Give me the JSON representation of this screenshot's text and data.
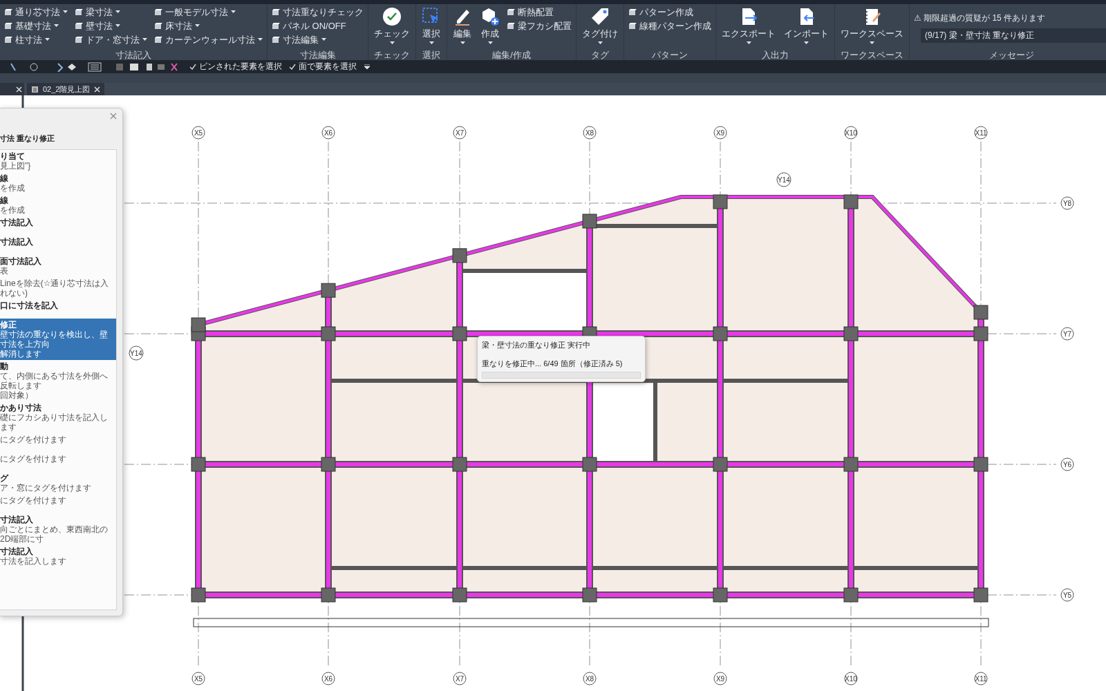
{
  "ribbon": {
    "groups": [
      {
        "label": "寸法記入",
        "items": [
          {
            "label": "通り芯寸法",
            "kind": "small",
            "dropdown": true
          },
          {
            "label": "基礎寸法",
            "kind": "small",
            "dropdown": true
          },
          {
            "label": "柱寸法",
            "kind": "small",
            "dropdown": true
          },
          {
            "label": "梁寸法",
            "kind": "small",
            "dropdown": true
          },
          {
            "label": "壁寸法",
            "kind": "small",
            "dropdown": true
          },
          {
            "label": "ドア・窓寸法",
            "kind": "small",
            "dropdown": true
          },
          {
            "label": "一般モデル寸法",
            "kind": "small",
            "dropdown": true
          },
          {
            "label": "床寸法",
            "kind": "small",
            "dropdown": true
          },
          {
            "label": "カーテンウォール寸法",
            "kind": "small",
            "dropdown": true
          }
        ]
      },
      {
        "label": "寸法編集",
        "items": [
          {
            "label": "寸法重なりチェック",
            "kind": "small",
            "dropdown": false
          },
          {
            "label": "パネル ON/OFF",
            "kind": "small",
            "dropdown": false
          },
          {
            "label": "寸法編集",
            "kind": "small",
            "dropdown": true
          }
        ]
      },
      {
        "label": "チェック",
        "items": [
          {
            "label": "チェック",
            "kind": "check",
            "dropdown": true
          }
        ]
      },
      {
        "label": "選択",
        "items": [
          {
            "label": "選択",
            "kind": "select",
            "dropdown": true
          }
        ]
      },
      {
        "label": "編集/作成",
        "items": [
          {
            "label": "編集",
            "kind": "edit",
            "dropdown": true
          },
          {
            "label": "作成",
            "kind": "create",
            "dropdown": true
          },
          {
            "label": "断熱配置",
            "kind": "small",
            "dropdown": false
          },
          {
            "label": "梁フカシ配置",
            "kind": "small",
            "dropdown": false
          }
        ]
      },
      {
        "label": "タグ",
        "items": [
          {
            "label": "タグ付け",
            "kind": "tag",
            "dropdown": true
          }
        ]
      },
      {
        "label": "パターン",
        "items": [
          {
            "label": "パターン作成",
            "kind": "small",
            "dropdown": false
          },
          {
            "label": "線種パターン作成",
            "kind": "small",
            "dropdown": false
          }
        ]
      },
      {
        "label": "入出力",
        "items": [
          {
            "label": "エクスポート",
            "kind": "export",
            "dropdown": true
          },
          {
            "label": "インポート",
            "kind": "import",
            "dropdown": true
          }
        ]
      },
      {
        "label": "ワークスペース",
        "items": [
          {
            "label": "ワークスペース",
            "kind": "workspace",
            "dropdown": true
          }
        ]
      }
    ],
    "message": {
      "label": "メッセージ",
      "warning": "⚠ 期限超過の質疑が 15 件あります",
      "value": "(9/17) 梁・壁寸法 重なり修正"
    }
  },
  "quick_toolbar": {
    "toggles": [
      {
        "label": "ピンされた要素を選択",
        "checked": true
      },
      {
        "label": "面で要素を選択",
        "checked": true
      }
    ]
  },
  "tabs": [
    {
      "label": "02_2階見上図",
      "selected": true
    }
  ],
  "panel": {
    "heading": "寸法 重なり修正",
    "steps": [
      {
        "title": "り当て",
        "lines": [
          "見上図\"}"
        ],
        "selected": false
      },
      {
        "title": "線",
        "lines": [
          "を作成"
        ],
        "selected": false
      },
      {
        "title": "線",
        "lines": [
          "を作成"
        ],
        "selected": false
      },
      {
        "title": "寸法記入",
        "selected": false
      },
      {
        "title": "寸法記入",
        "selected": false
      },
      {
        "title": "面寸法記入",
        "lines": [
          "表"
        ],
        "selected": false
      },
      {
        "lines": [
          "Lineを除去(☆通り芯寸法は入れない)"
        ],
        "selected": false
      },
      {
        "title": "口に寸法を記入",
        "selected": false
      },
      {
        "title": "修正",
        "lines": [
          "壁寸法の重なりを検出し、壁寸法を上方向",
          "解消します"
        ],
        "selected": true
      },
      {
        "title": "動",
        "lines": [
          "て、内側にある寸法を外側へ反転します",
          "回対象）"
        ],
        "selected": false
      },
      {
        "title": "かあり寸法",
        "lines": [
          "礎にフカシあり寸法を記入します"
        ],
        "selected": false
      },
      {
        "lines": [
          "にタグを付けます"
        ],
        "selected": false
      },
      {
        "lines": [
          "にタグを付けます"
        ],
        "selected": false
      },
      {
        "title": "グ",
        "lines": [
          "ア・窓にタグを付けます"
        ],
        "selected": false
      },
      {
        "lines": [
          "にタグを付けます"
        ],
        "selected": false
      },
      {
        "title": "寸法記入",
        "lines": [
          "向ごとにまとめ、東西南北の2D端部に寸"
        ],
        "selected": false
      },
      {
        "title": "寸法記入",
        "lines": [
          "寸法を記入します"
        ],
        "selected": false
      }
    ]
  },
  "progress_dialog": {
    "title": "梁・壁寸法の重なり修正 実行中",
    "status": "重なりを修正中... 6/49 箇所（修正済み 5)",
    "level": 0
  },
  "grid": {
    "columns_top": [
      "X5",
      "X6",
      "X7",
      "X8",
      "X9",
      "X10",
      "X11"
    ],
    "columns_bottom": [
      "X5",
      "X6",
      "X7",
      "X8",
      "X9",
      "X10",
      "X11"
    ],
    "rows_right": [
      "Y8",
      "Y7",
      "Y6",
      "Y5"
    ],
    "extra": [
      "Y14",
      "Y14"
    ]
  }
}
